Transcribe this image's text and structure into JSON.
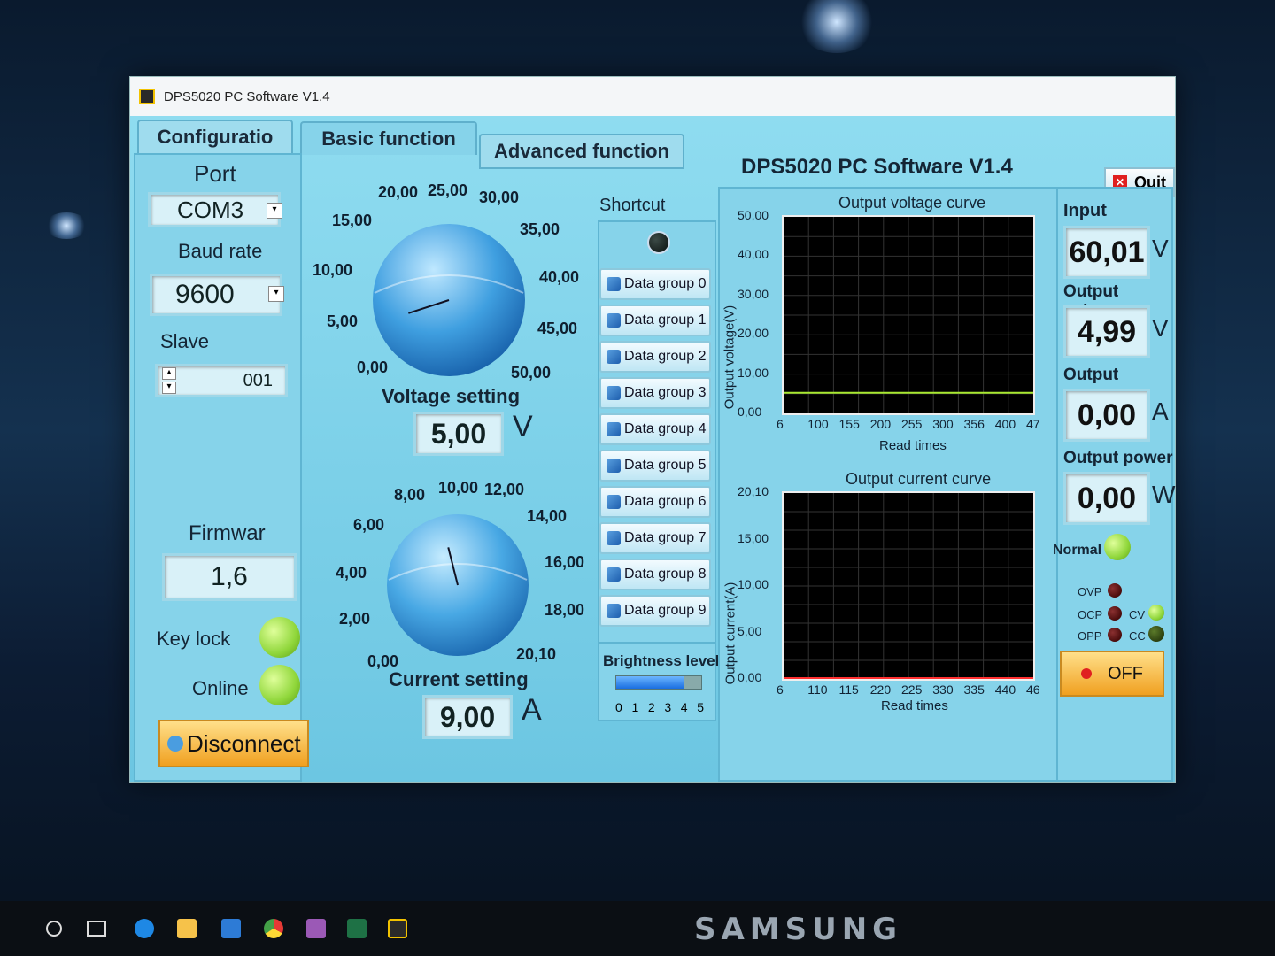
{
  "window": {
    "title": "DPS5020 PC Software V1.4"
  },
  "tabs": {
    "config": "Configuratio",
    "basic": "Basic function",
    "advanced": "Advanced function"
  },
  "header": {
    "title": "DPS5020 PC Software V1.4",
    "quit_label": "Quit"
  },
  "config": {
    "port_label": "Port",
    "port_value": "COM3",
    "baud_label": "Baud rate",
    "baud_value": "9600",
    "slave_label": "Slave",
    "slave_value": "001",
    "firmware_label": "Firmwar",
    "firmware_value": "1,6",
    "keylock_label": "Key lock",
    "online_label": "Online",
    "disconnect_label": "Disconnect"
  },
  "voltage_knob": {
    "ticks": [
      "0,00",
      "5,00",
      "10,00",
      "15,00",
      "20,00",
      "25,00",
      "30,00",
      "35,00",
      "40,00",
      "45,00",
      "50,00"
    ],
    "label": "Voltage setting",
    "value": "5,00",
    "unit": "V",
    "setting": 5.0,
    "max": 50
  },
  "current_knob": {
    "ticks": [
      "0,00",
      "2,00",
      "4,00",
      "6,00",
      "8,00",
      "10,00",
      "12,00",
      "14,00",
      "16,00",
      "18,00",
      "20,10"
    ],
    "label": "Current setting",
    "value": "9,00",
    "unit": "A",
    "setting": 9.0,
    "max": 20.1
  },
  "shortcut": {
    "label": "Shortcut",
    "groups": [
      "Data group 0",
      "Data group 1",
      "Data group 2",
      "Data group 3",
      "Data group 4",
      "Data group 5",
      "Data group 6",
      "Data group 7",
      "Data group 8",
      "Data group 9"
    ]
  },
  "brightness": {
    "label": "Brightness level",
    "ticks": [
      "0",
      "1",
      "2",
      "3",
      "4",
      "5"
    ],
    "level": 4
  },
  "chart_data": [
    {
      "type": "line",
      "title": "Output voltage curve",
      "xlabel": "Read times",
      "ylabel": "Output voltage(V)",
      "y_ticks": [
        "0,00",
        "10,00",
        "20,00",
        "30,00",
        "40,00",
        "50,00"
      ],
      "x_ticks": [
        "6",
        "100",
        "155",
        "200",
        "255",
        "300",
        "356",
        "400",
        "47"
      ],
      "ylim": [
        0,
        50
      ],
      "series": [
        {
          "values": [
            5,
            5,
            5,
            5,
            5,
            5,
            5,
            5,
            5
          ],
          "color": "#a8e830"
        }
      ]
    },
    {
      "type": "line",
      "title": "Output current curve",
      "xlabel": "Read times",
      "ylabel": "Output current(A)",
      "y_ticks": [
        "0,00",
        "5,00",
        "10,00",
        "15,00",
        "20,10"
      ],
      "x_ticks": [
        "6",
        "110",
        "115",
        "220",
        "225",
        "330",
        "335",
        "440",
        "46"
      ],
      "ylim": [
        0,
        20.1
      ],
      "series": [
        {
          "values": [
            0,
            0,
            0,
            0,
            0,
            0,
            0,
            0,
            0
          ],
          "color": "#ff3030"
        }
      ]
    }
  ],
  "readouts": {
    "input_label": "Input",
    "input_value": "60,01",
    "input_unit": "V",
    "vout_label": "Output voltage",
    "vout_value": "4,99",
    "vout_unit": "V",
    "iout_label": "Output",
    "iout_value": "0,00",
    "iout_unit": "A",
    "pout_label": "Output power",
    "pout_value": "0,00",
    "pout_unit": "W"
  },
  "status": {
    "normal_label": "Normal",
    "ovp": "OVP",
    "ocp": "OCP",
    "opp": "OPP",
    "cv": "CV",
    "cc": "CC",
    "off_label": "OFF"
  },
  "monitor_brand": "SAMSUNG",
  "colors": {
    "panel_bg": "#86d3ea",
    "accent_orange": "#f0a020",
    "led_green": "#8fd63a"
  }
}
